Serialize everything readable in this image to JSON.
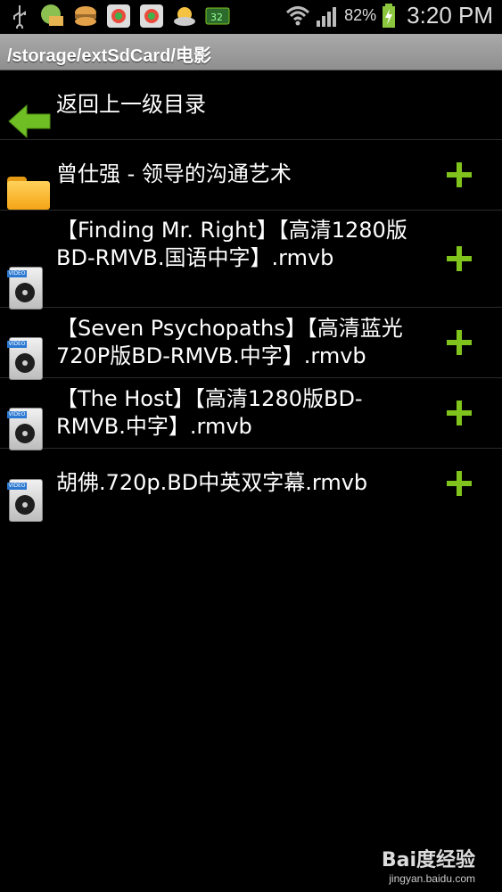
{
  "statusbar": {
    "battery": "82%",
    "time": "3:20 PM",
    "notification_icons": [
      "usb-icon",
      "mail-icon",
      "burger-icon",
      "app-icon",
      "app-icon",
      "weather-icon",
      "battery-app-icon"
    ]
  },
  "path": "/storage/extSdCard/电影",
  "back_label": "返回上一级目录",
  "items": [
    {
      "type": "folder",
      "label": "曾仕强 - 领导的沟通艺术"
    },
    {
      "type": "video",
      "label": "【Finding Mr. Right】【高清1280版BD-RMVB.国语中字】.rmvb"
    },
    {
      "type": "video",
      "label": "【Seven Psychopaths】【高清蓝光720P版BD-RMVB.中字】.rmvb"
    },
    {
      "type": "video",
      "label": "【The Host】【高清1280版BD-RMVB.中字】.rmvb"
    },
    {
      "type": "video",
      "label": "胡佛.720p.BD中英双字幕.rmvb"
    }
  ],
  "video_tag": "VIDEO",
  "watermark": {
    "logo": "Bai度经验",
    "url": "jingyan.baidu.com"
  },
  "colors": {
    "accent_plus": "#7fc31c",
    "pathbar": "#9a9a9a"
  }
}
